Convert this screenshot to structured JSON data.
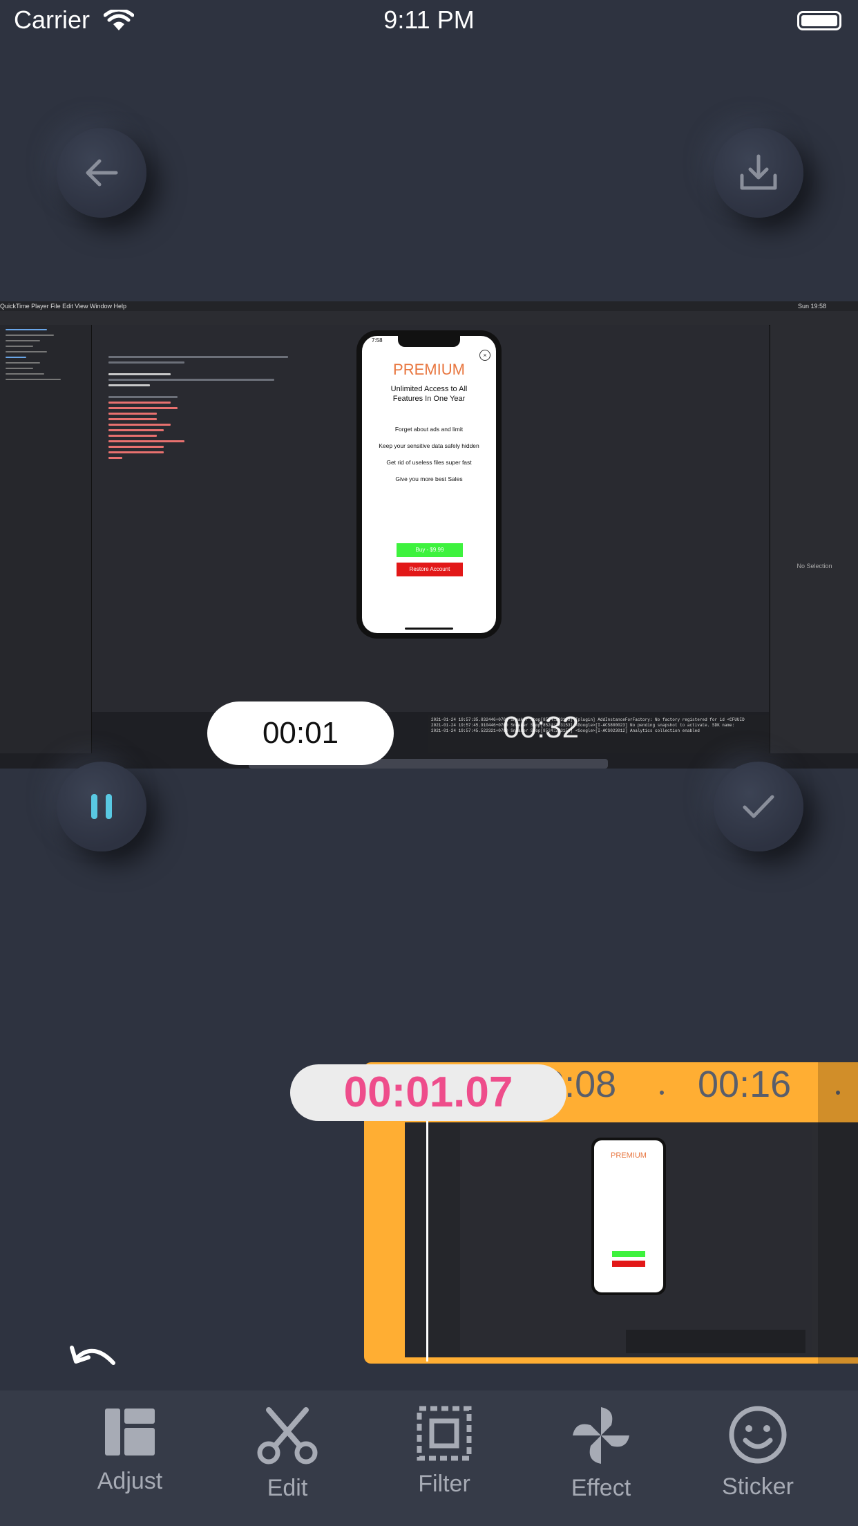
{
  "status_bar": {
    "carrier": "Carrier",
    "time": "9:11 PM"
  },
  "icons": {
    "back": "arrow-left-icon",
    "download": "download-icon",
    "pause": "pause-icon",
    "confirm": "checkmark-icon",
    "undo": "undo-icon"
  },
  "preview": {
    "mac_menu": " QuickTime Player   File   Edit   View   Window   Help",
    "mac_clock": "Sun 19:58",
    "inspector_text": "No Selection",
    "console_lines": [
      "2021-01-24 19:57:35.832446+0700 Sneaker Shop[8524:203153] [plugin] AddInstanceForFactory: No factory registered for id <CFUUID",
      "2021-01-24 19:57:45.910446+0700 Sneaker Shop[8524:203153] <Google>[I-ACS800023] No pending snapshot to activate. SDK name:",
      "2021-01-24 19:57:45.522321+0700 Sneaker Shop[8524:203153] <Google>[I-ACS023012] Analytics collection enabled"
    ],
    "phone": {
      "time": "7:58",
      "title": "PREMIUM",
      "subtitle": "Unlimited Access to All Features In One Year",
      "features": [
        "Forget about ads and limit",
        "Keep your sensitive data safely hidden",
        "Get rid of useless files super fast",
        "Give you more best Sales"
      ],
      "buy_label": "Buy - $9.99",
      "restore_label": "Restore Account"
    }
  },
  "recording_timer": "00:01",
  "overlay_timer": "00:32",
  "timeline": {
    "current_time": "00:01.07",
    "ticks": [
      "00:08",
      "00:16"
    ]
  },
  "toolbar": {
    "items": [
      {
        "label": "Adjust",
        "icon": "adjust-icon"
      },
      {
        "label": "Edit",
        "icon": "scissors-icon"
      },
      {
        "label": "Filter",
        "icon": "filter-icon"
      },
      {
        "label": "Effect",
        "icon": "pinwheel-icon"
      },
      {
        "label": "Sticker",
        "icon": "smiley-icon"
      }
    ]
  },
  "colors": {
    "background": "#2e3340",
    "accent_pink": "#ee4d8b",
    "accent_cyan": "#59c9e3",
    "timeline_orange": "#ffae33",
    "toolbar": "#363b48"
  }
}
